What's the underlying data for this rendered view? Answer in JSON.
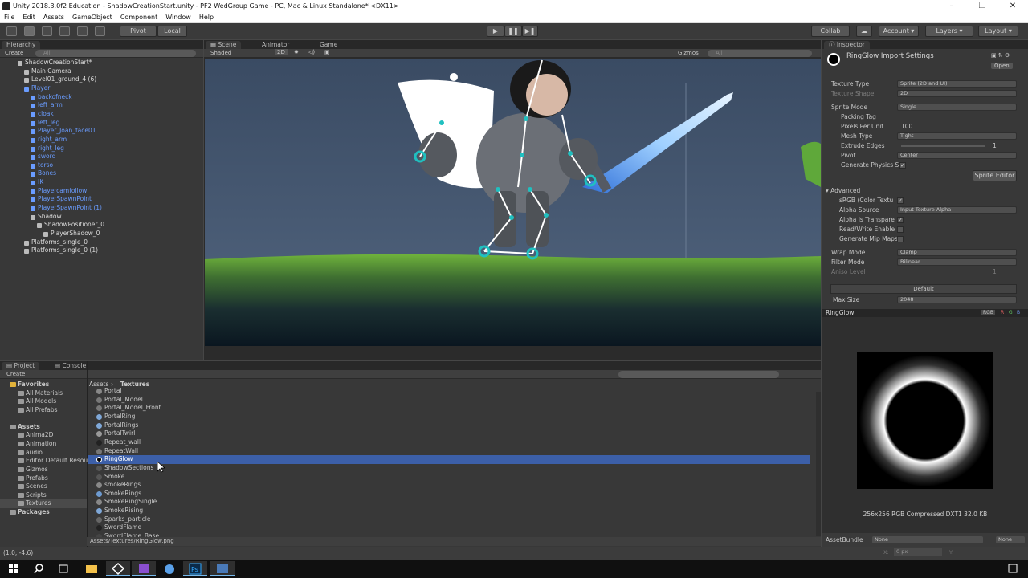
{
  "window": {
    "title": "Unity 2018.3.0f2 Education - ShadowCreationStart.unity - PF2 WedGroup Game - PC, Mac & Linux Standalone* <DX11>"
  },
  "menu": [
    "File",
    "Edit",
    "Assets",
    "GameObject",
    "Component",
    "Window",
    "Help"
  ],
  "toolbar": {
    "pivot": "Pivot",
    "local": "Local",
    "collab": "Collab",
    "account": "Account",
    "layers": "Layers",
    "layout": "Layout"
  },
  "hierarchy": {
    "tab": "Hierarchy",
    "create": "Create",
    "search_placeholder": "All",
    "items": [
      {
        "label": "ShadowCreationStart*",
        "indent": 0,
        "color": "white"
      },
      {
        "label": "Main Camera",
        "indent": 1,
        "color": "white"
      },
      {
        "label": "Level01_ground_4 (6)",
        "indent": 1,
        "color": "white"
      },
      {
        "label": "Player",
        "indent": 1,
        "color": "blue"
      },
      {
        "label": "backofneck",
        "indent": 2,
        "color": "blue"
      },
      {
        "label": "left_arm",
        "indent": 2,
        "color": "blue"
      },
      {
        "label": "cloak",
        "indent": 2,
        "color": "blue"
      },
      {
        "label": "left_leg",
        "indent": 2,
        "color": "blue"
      },
      {
        "label": "Player_Joan_face01",
        "indent": 2,
        "color": "blue"
      },
      {
        "label": "right_arm",
        "indent": 2,
        "color": "blue"
      },
      {
        "label": "right_leg",
        "indent": 2,
        "color": "blue"
      },
      {
        "label": "sword",
        "indent": 2,
        "color": "blue"
      },
      {
        "label": "torso",
        "indent": 2,
        "color": "blue"
      },
      {
        "label": "Bones",
        "indent": 2,
        "color": "blue"
      },
      {
        "label": "IK",
        "indent": 2,
        "color": "blue"
      },
      {
        "label": "Playercamfollow",
        "indent": 2,
        "color": "blue"
      },
      {
        "label": "PlayerSpawnPoint",
        "indent": 2,
        "color": "blue"
      },
      {
        "label": "PlayerSpawnPoint (1)",
        "indent": 2,
        "color": "blue"
      },
      {
        "label": "Shadow",
        "indent": 2,
        "color": "white"
      },
      {
        "label": "ShadowPositioner_0",
        "indent": 3,
        "color": "white"
      },
      {
        "label": "PlayerShadow_0",
        "indent": 4,
        "color": "white"
      },
      {
        "label": "Platforms_single_0",
        "indent": 1,
        "color": "white"
      },
      {
        "label": "Platforms_single_0 (1)",
        "indent": 1,
        "color": "white"
      }
    ]
  },
  "scene": {
    "tabs": [
      "Scene",
      "Animator",
      "Game"
    ],
    "shading": "Shaded",
    "mode_2d": "2D",
    "gizmos": "Gizmos",
    "search_placeholder": "All"
  },
  "inspector": {
    "tab": "Inspector",
    "title": "RingGlow Import Settings",
    "open": "Open",
    "rows": [
      {
        "label": "Texture Type",
        "value": "Sprite (2D and UI)"
      },
      {
        "label": "Texture Shape",
        "value": "2D"
      },
      {
        "label": "Sprite Mode",
        "value": "Single"
      },
      {
        "label": "Packing Tag",
        "value": ""
      },
      {
        "label": "Pixels Per Unit",
        "value": "100"
      },
      {
        "label": "Mesh Type",
        "value": "Tight"
      },
      {
        "label": "Extrude Edges",
        "value": "1"
      },
      {
        "label": "Pivot",
        "value": "Center"
      },
      {
        "label": "Generate Physics S",
        "value": ""
      }
    ],
    "sprite_editor": "Sprite Editor",
    "advanced": "Advanced",
    "adv_rows": [
      {
        "label": "sRGB (Color Textu",
        "value": ""
      },
      {
        "label": "Alpha Source",
        "value": "Input Texture Alpha"
      },
      {
        "label": "Alpha Is Transpare",
        "value": ""
      },
      {
        "label": "Read/Write Enable",
        "value": ""
      },
      {
        "label": "Generate Mip Maps",
        "value": ""
      }
    ],
    "wrap_mode": {
      "label": "Wrap Mode",
      "value": "Clamp"
    },
    "filter_mode": {
      "label": "Filter Mode",
      "value": "Bilinear"
    },
    "aniso": {
      "label": "Aniso Level",
      "value": "1"
    },
    "platform": "Default",
    "max_size": {
      "label": "Max Size",
      "value": "2048"
    }
  },
  "preview": {
    "name": "RingGlow",
    "channels": [
      "RGB",
      "R",
      "G",
      "B"
    ],
    "info": "256x256  RGB Compressed DXT1   32.0 KB",
    "asset_bundle": "AssetBundle",
    "bundle_value": "None",
    "variant_value": "None"
  },
  "project": {
    "tabs": [
      "Project",
      "Console"
    ],
    "create": "Create",
    "breadcrumb": [
      "Assets",
      "Textures"
    ],
    "favorites": {
      "title": "Favorites",
      "items": [
        "All Materials",
        "All Models",
        "All Prefabs"
      ]
    },
    "assets": {
      "title": "Assets",
      "items": [
        "Anima2D",
        "Animation",
        "audio",
        "Editor Default Resou",
        "Gizmos",
        "Prefabs",
        "Scenes",
        "Scripts",
        "Textures"
      ]
    },
    "packages": "Packages",
    "files": [
      {
        "name": "Portal",
        "icon": "#888888"
      },
      {
        "name": "Portal_Model",
        "icon": "#777777"
      },
      {
        "name": "Portal_Model_Front",
        "icon": "#777777"
      },
      {
        "name": "PortalRing",
        "icon": "#7fa8d8"
      },
      {
        "name": "PortalRings",
        "icon": "#7fa8d8"
      },
      {
        "name": "PortalTwirl",
        "icon": "#999999"
      },
      {
        "name": "Repeat_wall",
        "icon": "#222222"
      },
      {
        "name": "RepeatWall",
        "icon": "#777777"
      },
      {
        "name": "RingGlow",
        "icon": "#000000"
      },
      {
        "name": "ShadowSections",
        "icon": "#555555"
      },
      {
        "name": "Smoke",
        "icon": "#555555"
      },
      {
        "name": "smokeRings",
        "icon": "#888888"
      },
      {
        "name": "SmokeRings",
        "icon": "#6d9ad0"
      },
      {
        "name": "SmokeRingSingle",
        "icon": "#888888"
      },
      {
        "name": "SmokeRising",
        "icon": "#7fa8d8"
      },
      {
        "name": "Sparks_particle",
        "icon": "#666666"
      },
      {
        "name": "SwordFlame",
        "icon": "#222222"
      },
      {
        "name": "SwordFlame_Base",
        "icon": "#444444"
      }
    ],
    "selected_path": "Assets/Textures/RingGlow.png"
  },
  "status": {
    "coords": "(1.0, -4.6)",
    "x_label": "X:",
    "x_value": "0 px",
    "y_label": "Y:"
  }
}
